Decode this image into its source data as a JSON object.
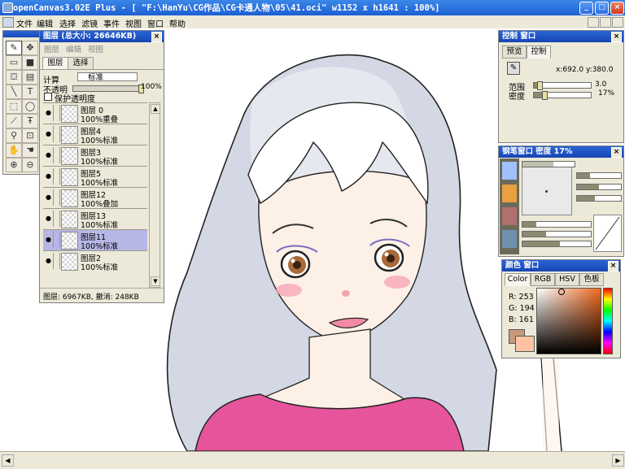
{
  "window": {
    "title": "openCanvas3.02E Plus - [ \"F:\\HanYu\\CG作品\\CG卡通人物\\05\\41.oci\" w1152 x h1641 : 100%]",
    "min_label": "_",
    "max_label": "□",
    "close_label": "×"
  },
  "menu": [
    "文件",
    "编辑",
    "选择",
    "滤镜",
    "事件",
    "视图",
    "窗口",
    "帮助"
  ],
  "layers_panel": {
    "title": "图层 (总大小: 26646KB)",
    "menus": [
      "图层",
      "编辑",
      "视图"
    ],
    "tabs": [
      "图层",
      "选择"
    ],
    "calc_label": "计算",
    "calc_value": "标准",
    "opacity_label": "不透明",
    "opacity_value": "100%",
    "preserve_label": "保护透明度",
    "layers": [
      {
        "name": "图层 0",
        "mode": "100%重叠",
        "selected": false
      },
      {
        "name": "图层4",
        "mode": "100%标准",
        "selected": false
      },
      {
        "name": "图层3",
        "mode": "100%标准",
        "selected": false
      },
      {
        "name": "图层5",
        "mode": "100%标准",
        "selected": false
      },
      {
        "name": "图层12",
        "mode": "100%叠加",
        "selected": false
      },
      {
        "name": "图层13",
        "mode": "100%标准",
        "selected": false
      },
      {
        "name": "图层11",
        "mode": "100%标准",
        "selected": true
      },
      {
        "name": "图层2",
        "mode": "100%标准",
        "selected": false
      }
    ],
    "status": "图层: 6967KB, 撤消: 248KB"
  },
  "control_panel": {
    "title": "控制 窗口",
    "tabs": [
      "预览",
      "控制"
    ],
    "coords": "x:692.0  y:380.0",
    "range_label": "范围",
    "range_value": "3.0",
    "density_label": "密度",
    "density_value": "17%"
  },
  "brush_panel": {
    "title": "钢笔窗口   密度   17%"
  },
  "color_panel": {
    "title": "颜色 窗口",
    "tabs": [
      "Color",
      "RGB",
      "HSV",
      "色板"
    ],
    "r_label": "R: 253",
    "g_label": "G: 194",
    "b_label": "B: 161",
    "primary_color": "#fdc2a1",
    "secondary_color": "#c8997a"
  }
}
